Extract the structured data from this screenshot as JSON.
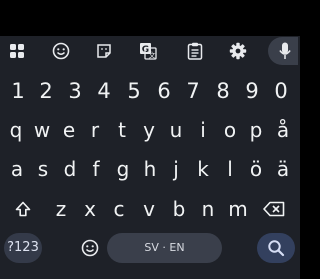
{
  "keyboard": {
    "toolbar": {
      "items": [
        "apps-grid-icon",
        "emoji-icon",
        "sticker-icon",
        "translate-icon",
        "clipboard-icon",
        "settings-gear-icon",
        "microphone-icon"
      ]
    },
    "number_row": [
      "1",
      "2",
      "3",
      "4",
      "5",
      "6",
      "7",
      "8",
      "9",
      "0"
    ],
    "row1": [
      "q",
      "w",
      "e",
      "r",
      "t",
      "y",
      "u",
      "i",
      "o",
      "p",
      "å"
    ],
    "row2": [
      "a",
      "s",
      "d",
      "f",
      "g",
      "h",
      "j",
      "k",
      "l",
      "ö",
      "ä"
    ],
    "row3": [
      "z",
      "x",
      "c",
      "v",
      "b",
      "n",
      "m"
    ],
    "bottom": {
      "symbols_label": "?123",
      "space_label": "SV · EN"
    },
    "colors": {
      "background": "#1e2128",
      "key_text": "#f1f3f4",
      "accent": "#33405e"
    }
  }
}
